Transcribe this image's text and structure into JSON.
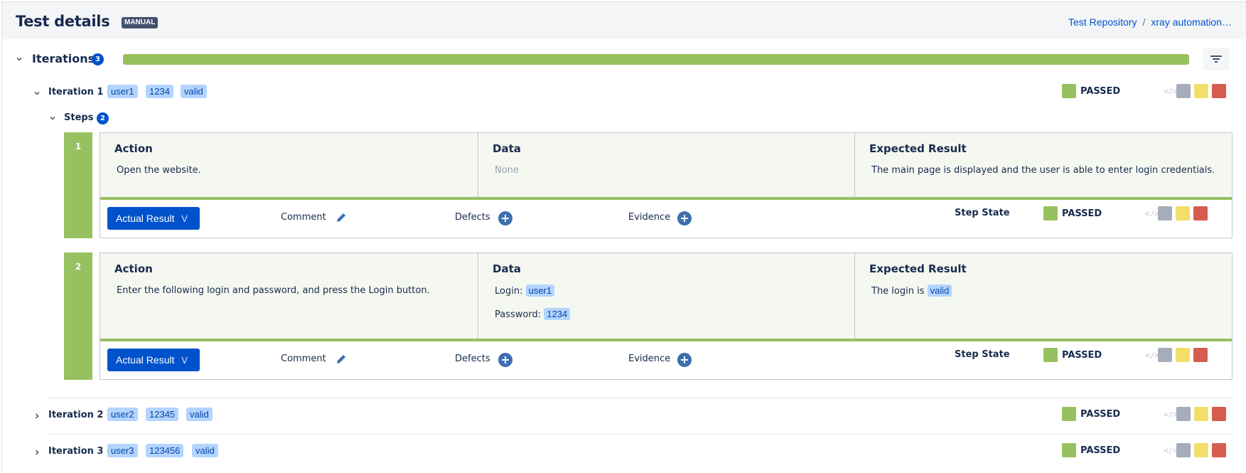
{
  "header": {
    "title": "Test details",
    "test_type": "MANUAL",
    "breadcrumb": [
      {
        "label": "Test Repository"
      },
      {
        "label": "xray automation…"
      }
    ],
    "breadcrumb_separator": "/"
  },
  "iterations": {
    "label": "Iterations",
    "count": "3",
    "progress": {
      "passed_fraction": 1.0,
      "color": "#97c160"
    },
    "filter_icon": "filter-icon"
  },
  "status_colors": {
    "passed": "#97c160",
    "todo": "#a5adba",
    "executing": "#f1df6a",
    "failed": "#d45d4e"
  },
  "iteration_list": [
    {
      "title": "Iteration 1 -",
      "params": [
        "user1",
        "1234",
        "valid"
      ],
      "status": "PASSED",
      "expanded": true,
      "steps_label": "Steps",
      "steps_count": "2",
      "steps": [
        {
          "number": "1",
          "action_head": "Action",
          "action": "Open the website.",
          "data_head": "Data",
          "data_none": "None",
          "expected_head": "Expected Result",
          "expected": "The main page is displayed and the user is able to enter login credentials.",
          "actual_result_label": "Actual Result",
          "comment_label": "Comment",
          "defects_label": "Defects",
          "evidence_label": "Evidence",
          "step_state_label": "Step State",
          "status": "PASSED"
        },
        {
          "number": "2",
          "action_head": "Action",
          "action": "Enter the following login and password, and press the Login button.",
          "data_head": "Data",
          "data_login_label": "Login:",
          "data_login_value": "user1",
          "data_password_label": "Password:",
          "data_password_value": "1234",
          "expected_head": "Expected Result",
          "expected_prefix": "The login is",
          "expected_value": "valid",
          "actual_result_label": "Actual Result",
          "comment_label": "Comment",
          "defects_label": "Defects",
          "evidence_label": "Evidence",
          "step_state_label": "Step State",
          "status": "PASSED"
        }
      ]
    },
    {
      "title": "Iteration 2 -",
      "params": [
        "user2",
        "12345",
        "valid"
      ],
      "status": "PASSED",
      "expanded": false
    },
    {
      "title": "Iteration 3 -",
      "params": [
        "user3",
        "123456",
        "valid"
      ],
      "status": "PASSED",
      "expanded": false
    }
  ],
  "quick_status_code_glyph": "</>"
}
